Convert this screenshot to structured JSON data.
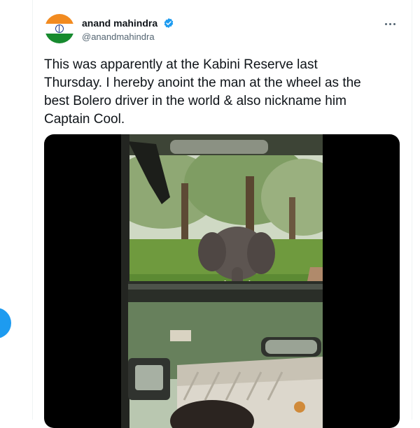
{
  "colors": {
    "accent": "#1d9bf0",
    "text_primary": "#0f1419",
    "text_secondary": "#536471",
    "media_background": "#000000"
  },
  "side_nav": {
    "compose_button_icon": "feather-icon"
  },
  "tweet": {
    "author": {
      "display_name": "anand mahindra",
      "handle": "@anandmahindra",
      "verified": true,
      "avatar_icon": "indian-flag-avatar"
    },
    "more_icon": "more-horizontal-icon",
    "text": "This was apparently at the Kabini Reserve last\nThursday. I hereby anoint the man at the wheel as the\nbest Bolero driver in the world & also nickname him\nCaptain Cool.",
    "media": {
      "type": "video",
      "scene": "elephant-facing-open-jeep-in-forest"
    }
  }
}
